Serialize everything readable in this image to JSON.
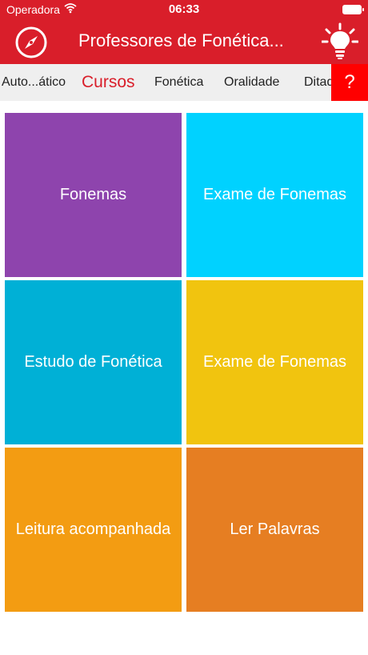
{
  "status": {
    "carrier": "Operadora",
    "time": "06:33"
  },
  "navbar": {
    "title": "Professores de Fonética...",
    "left_icon": "compass-icon",
    "right_icon": "lightbulb-icon"
  },
  "tabs": [
    {
      "label": "Auto...ático",
      "active": false
    },
    {
      "label": "Cursos",
      "active": true
    },
    {
      "label": "Fonética",
      "active": false
    },
    {
      "label": "Oralidade",
      "active": false
    },
    {
      "label": "Ditad",
      "active": false
    }
  ],
  "help": {
    "label": "?"
  },
  "tiles": [
    {
      "label": "Fonemas",
      "color": "#8e44ad"
    },
    {
      "label": "Exame de Fonemas",
      "color": "#00d2ff"
    },
    {
      "label": "Estudo de Fonética",
      "color": "#00b0d6"
    },
    {
      "label": "Exame de Fonemas",
      "color": "#f1c40f"
    },
    {
      "label": "Leitura acompanhada",
      "color": "#f39c12"
    },
    {
      "label": "Ler Palavras",
      "color": "#e67e22"
    }
  ],
  "colors": {
    "accent": "#d91e2a",
    "help": "#ff0000"
  }
}
